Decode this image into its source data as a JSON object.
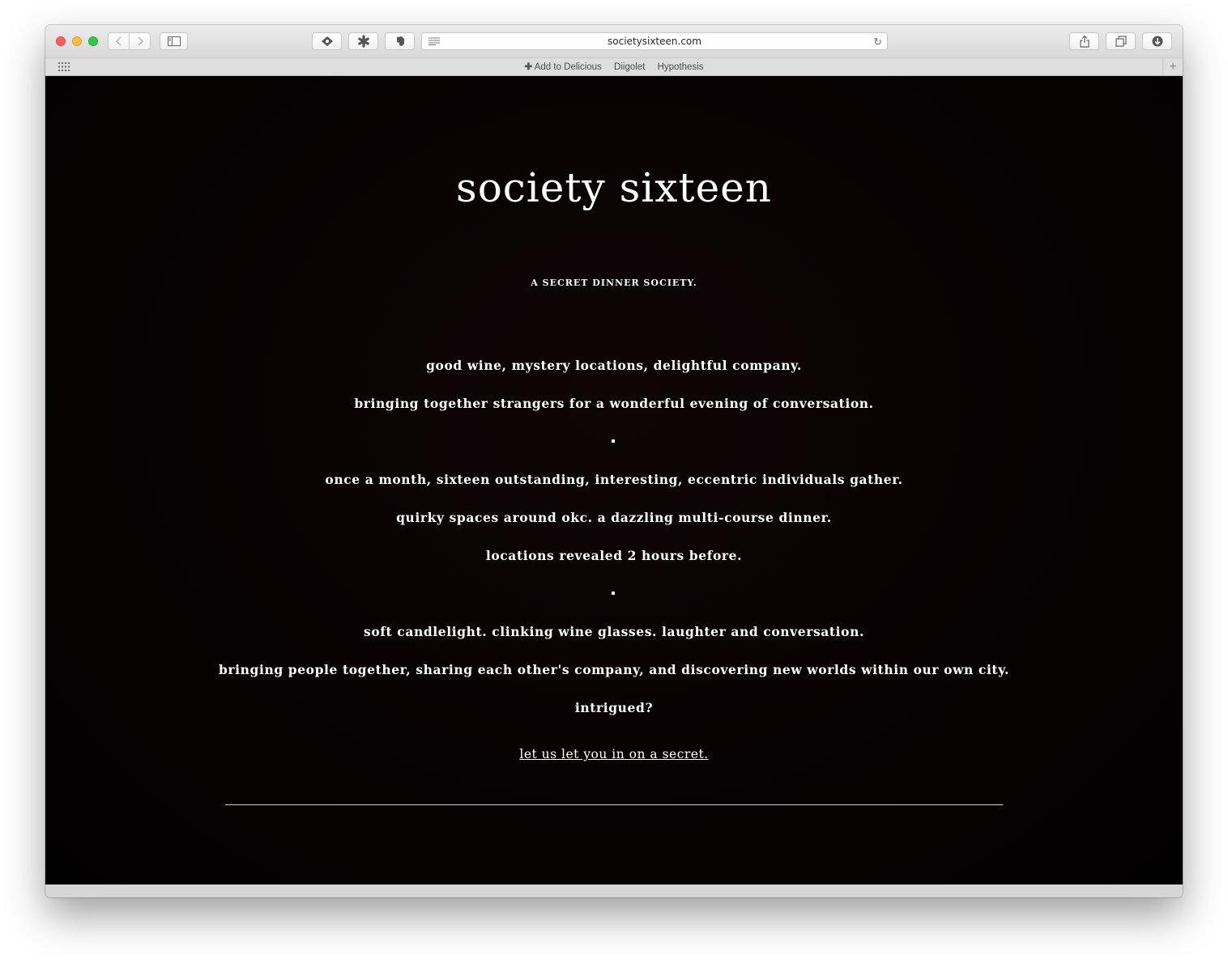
{
  "browser": {
    "url": "societysixteen.com",
    "bookmarks": [
      "Add to Delicious",
      "Diigolet",
      "Hypothesis"
    ]
  },
  "site": {
    "title": "society sixteen",
    "tagline": "A SECRET DINNER SOCIETY.",
    "lines": [
      "good wine, mystery locations, delightful company.",
      "bringing together strangers for a wonderful evening of conversation.",
      "once a month, sixteen outstanding, interesting, eccentric individuals gather.",
      "quirky spaces around okc. a dazzling multi-course dinner.",
      "locations revealed 2 hours before.",
      "soft candlelight. clinking wine glasses. laughter and conversation.",
      "bringing people together, sharing each other's company, and discovering new worlds within our own city.",
      "intrigued?"
    ],
    "cta_link": "let us let you in on a secret."
  },
  "colors": {
    "background": "#050203",
    "text": "#ffffff",
    "close": "#fc605c",
    "minimize": "#fdbc40",
    "maximize": "#34c84a"
  }
}
